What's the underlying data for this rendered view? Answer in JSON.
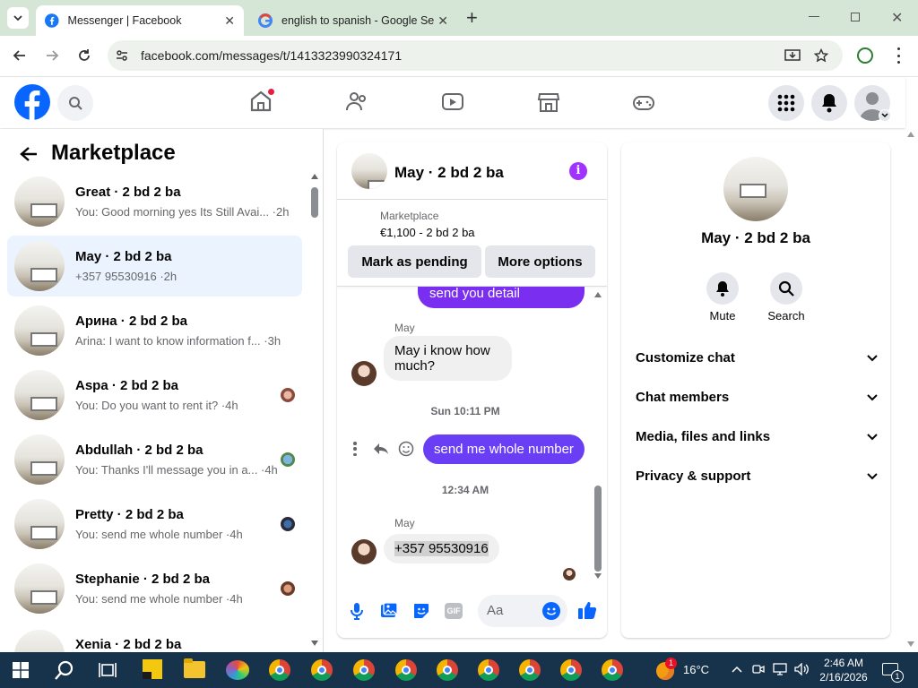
{
  "browser": {
    "tabs": [
      {
        "title": "Messenger | Facebook",
        "active": true
      },
      {
        "title": "english to spanish - Google Sea",
        "active": false
      }
    ],
    "url": "facebook.com/messages/t/1413323990324171"
  },
  "left_panel": {
    "title": "Marketplace",
    "conversations": [
      {
        "name": "Great · 2 bd 2 ba",
        "preview": "You: Good morning yes Its Still Avai... ·2h"
      },
      {
        "name": "May · 2 bd 2 ba",
        "preview": "+357 95530916 ·2h",
        "selected": true
      },
      {
        "name": "Арина · 2 bd 2 ba",
        "preview": "Arina: I want to know information f... ·3h"
      },
      {
        "name": "Aspa · 2 bd 2 ba",
        "preview": "You: Do you want to rent it? ·4h"
      },
      {
        "name": "Abdullah · 2 bd 2 ba",
        "preview": "You: Thanks I'll message you in a... ·4h"
      },
      {
        "name": "Pretty · 2 bd 2 ba",
        "preview": "You: send me whole number ·4h"
      },
      {
        "name": "Stephanie · 2 bd 2 ba",
        "preview": "You: send me whole number ·4h"
      },
      {
        "name": "Xenia · 2 bd 2 ba",
        "preview": ""
      }
    ]
  },
  "chat": {
    "title": "May · 2 bd 2 ba",
    "listing_source": "Marketplace",
    "listing_price": "€1,100 - 2 bd 2 ba",
    "mark_pending": "Mark as pending",
    "more_options": "More options",
    "partial_out": "send you detail",
    "sender1": "May",
    "msg1": "May i know how much?",
    "timestamp1": "Sun 10:11 PM",
    "out_msg": "send me whole number",
    "timestamp2": "12:34 AM",
    "sender2": "May",
    "msg2": "+357 95530916",
    "input_placeholder": "Aa"
  },
  "right_panel": {
    "name": "May · 2 bd 2 ba",
    "mute": "Mute",
    "search": "Search",
    "sections": [
      "Customize chat",
      "Chat members",
      "Media, files and links",
      "Privacy & support"
    ]
  },
  "taskbar": {
    "weather": "16°C",
    "time": "2:46 AM",
    "date": "2/16/2026",
    "weather_badge": "1",
    "notif_count": "1"
  }
}
